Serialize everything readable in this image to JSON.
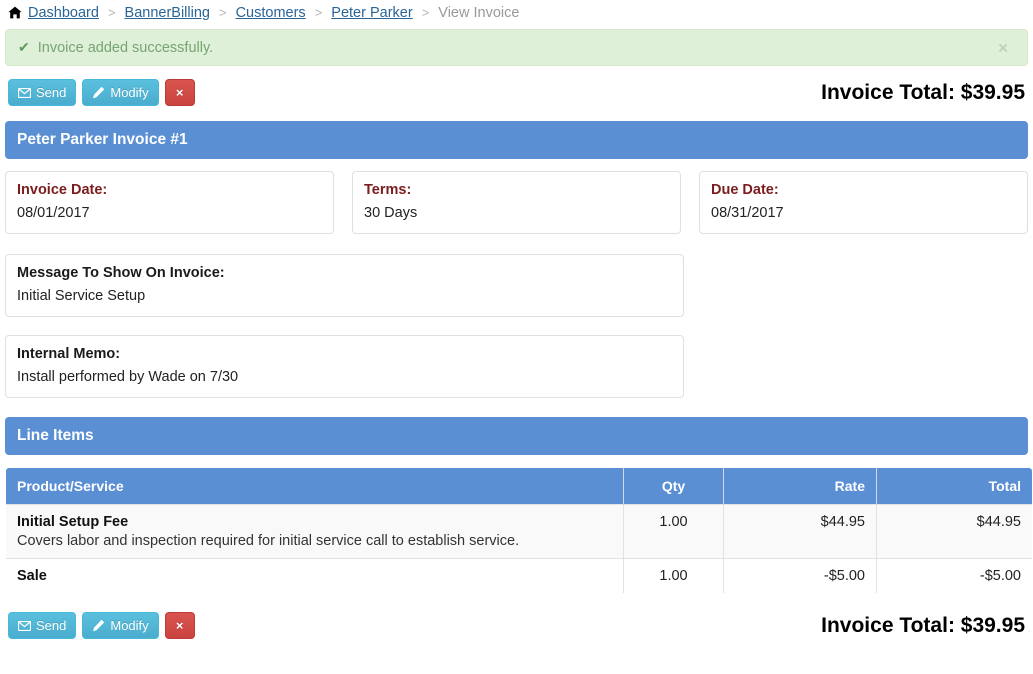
{
  "breadcrumb": {
    "home_icon": "home-icon",
    "separator": ">",
    "items": [
      {
        "label": "Dashboard",
        "current": false
      },
      {
        "label": "BannerBilling",
        "current": false
      },
      {
        "label": "Customers",
        "current": false
      },
      {
        "label": "Peter Parker",
        "current": false
      },
      {
        "label": "View Invoice",
        "current": true
      }
    ]
  },
  "alert": {
    "icon": "check-icon",
    "message": "Invoice added successfully.",
    "close_label": "×",
    "bg_color": "#dff0d8",
    "border_color": "#d6e9c6",
    "text_color": "#76a472"
  },
  "toolbar": {
    "send_label": "Send",
    "modify_label": "Modify",
    "delete_label": "×",
    "send_icon": "envelope-icon",
    "modify_icon": "pencil-icon",
    "delete_icon": "times-icon",
    "invoice_total": "Invoice Total: $39.95",
    "info_color": "#5bc0de",
    "danger_color": "#c9302c"
  },
  "invoice_panel": {
    "title": "Peter Parker Invoice #1",
    "header_color": "#5b8fd4",
    "fields": [
      {
        "label": "Invoice Date:",
        "value": "08/01/2017",
        "label_color": "#7b1d1d"
      },
      {
        "label": "Terms:",
        "value": "30 Days",
        "label_color": "#7b1d1d"
      },
      {
        "label": "Due Date:",
        "value": "08/31/2017",
        "label_color": "#7b1d1d"
      }
    ],
    "message_box": {
      "label": "Message To Show On Invoice:",
      "value": "Initial Service Setup"
    },
    "memo_box": {
      "label": "Internal Memo:",
      "value": "Install performed by Wade on 7/30"
    }
  },
  "line_items_panel": {
    "title": "Line Items",
    "columns": [
      {
        "label": "Product/Service",
        "align": "left"
      },
      {
        "label": "Qty",
        "align": "center"
      },
      {
        "label": "Rate",
        "align": "right"
      },
      {
        "label": "Total",
        "align": "right"
      }
    ],
    "rows": [
      {
        "name": "Initial Setup Fee",
        "description": "Covers labor and inspection required for initial service call to establish service.",
        "qty": "1.00",
        "rate": "$44.95",
        "total": "$44.95"
      },
      {
        "name": "Sale",
        "description": "",
        "qty": "1.00",
        "rate": "-$5.00",
        "total": "-$5.00"
      }
    ]
  }
}
